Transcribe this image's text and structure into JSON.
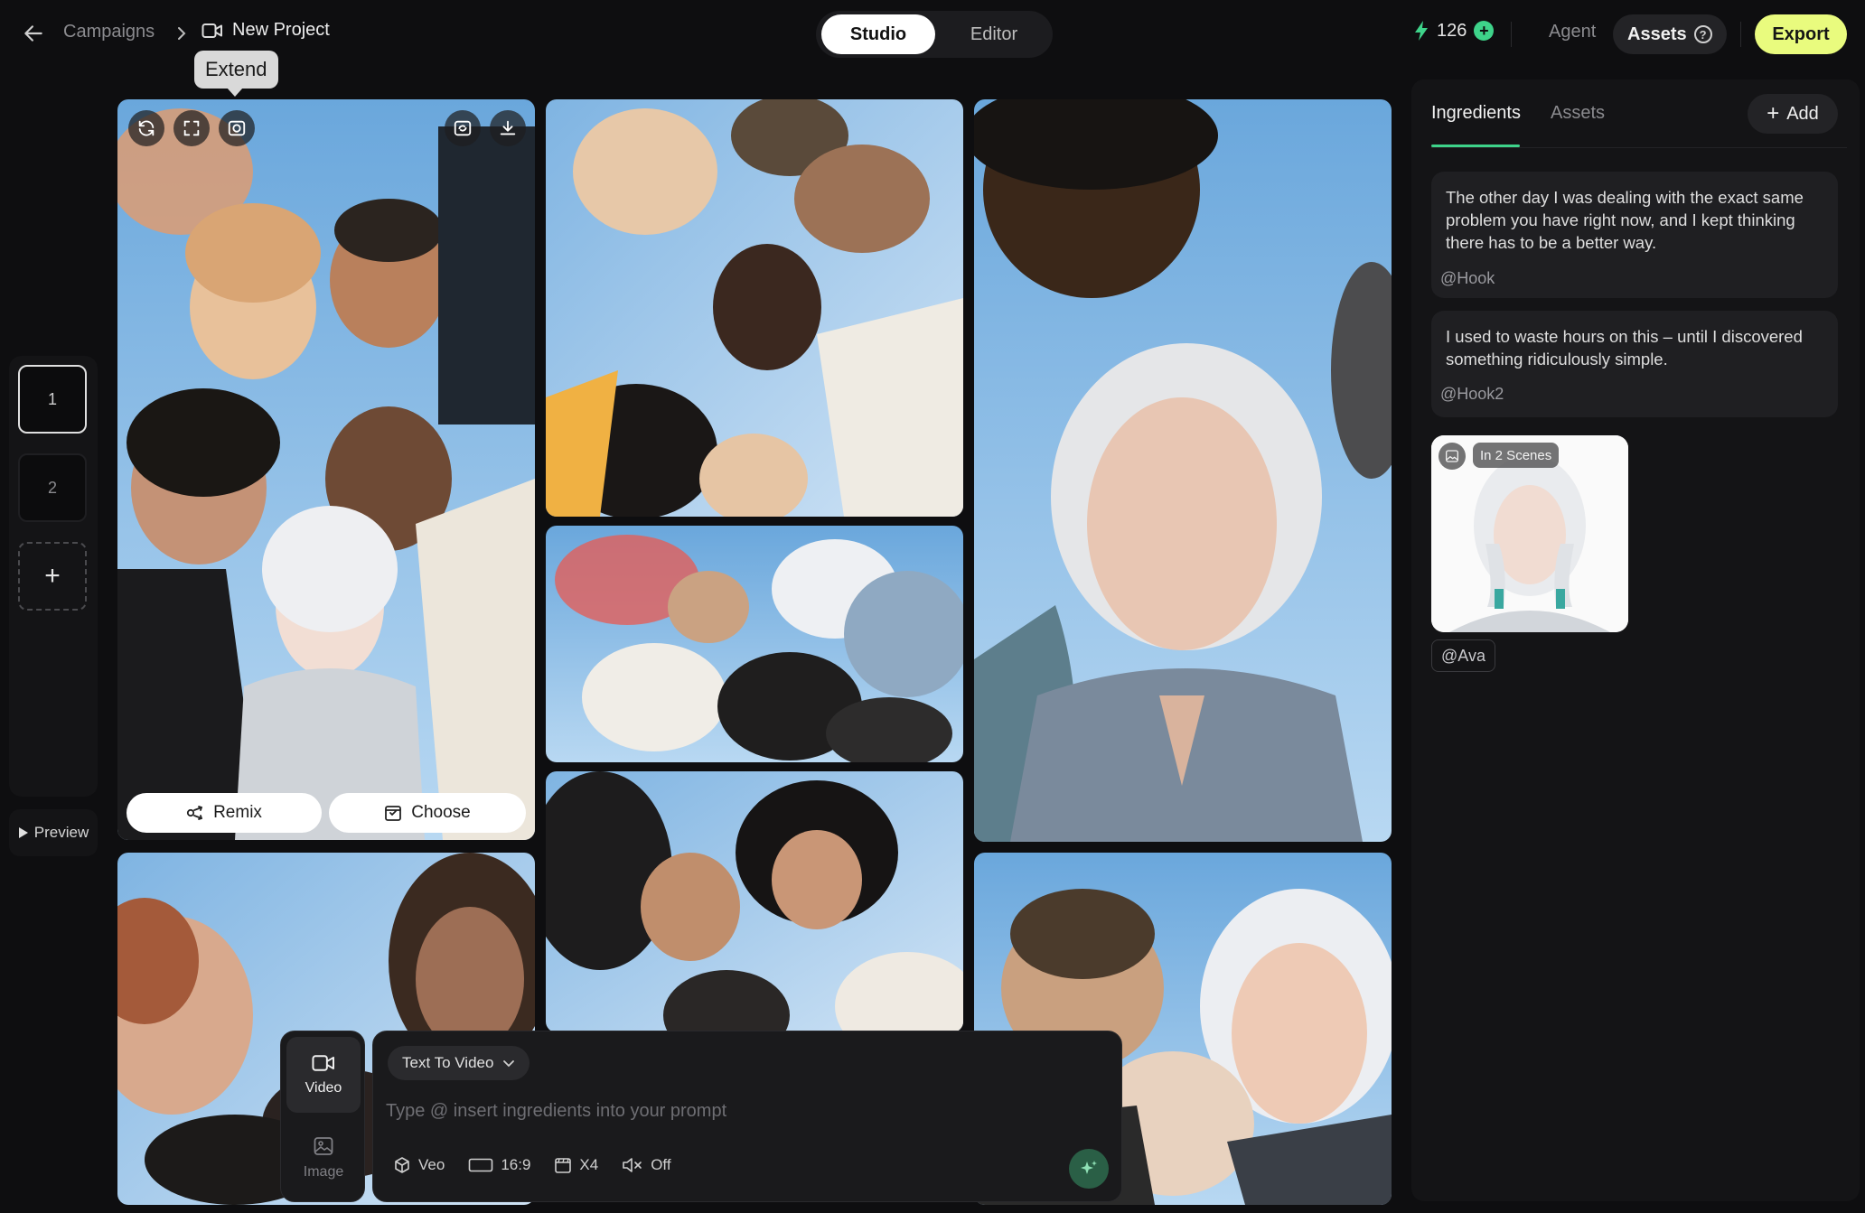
{
  "header": {
    "breadcrumb_root": "Campaigns",
    "project_name": "New Project",
    "tooltip": "Extend",
    "mode_tabs": {
      "studio": "Studio",
      "editor": "Editor"
    },
    "credits": "126",
    "agent_label": "Agent",
    "assets_label": "Assets",
    "export_label": "Export"
  },
  "scenes": {
    "items": [
      "1",
      "2"
    ],
    "preview_label": "Preview"
  },
  "gallery": {
    "remix_label": "Remix",
    "choose_label": "Choose"
  },
  "prompt": {
    "mode": "Text To Video",
    "placeholder": "Type @ insert ingredients into your prompt",
    "media": {
      "video": "Video",
      "image": "Image"
    },
    "options": {
      "model": "Veo",
      "aspect": "16:9",
      "count": "X4",
      "sound": "Off"
    }
  },
  "panel": {
    "tabs": {
      "ingredients": "Ingredients",
      "assets": "Assets"
    },
    "add_label": "Add",
    "cards": [
      {
        "text": "The other day I was dealing with the exact same problem you have right now, and I kept thinking there has to be a better way.",
        "tag": "@Hook"
      },
      {
        "text": "I used to waste hours on this – until I discovered something ridiculously simple.",
        "tag": "@Hook2"
      }
    ],
    "asset": {
      "badge": "In 2 Scenes",
      "tag": "@Ava"
    }
  },
  "colors": {
    "accent": "#3ed38a",
    "export": "#e9fb7e",
    "sky": "#8dbde6",
    "background": "#0e0e10"
  },
  "icons": [
    "back-arrow-icon",
    "chevron-right-icon",
    "video-camera-icon",
    "bolt-icon",
    "plus-icon",
    "help-icon",
    "refresh-icon",
    "fullscreen-icon",
    "extend-icon",
    "replace-image-icon",
    "download-icon",
    "remix-icon",
    "choose-icon",
    "image-icon",
    "cube-icon",
    "aspect-ratio-icon",
    "clapper-icon",
    "mute-icon",
    "sparkle-icon",
    "play-icon"
  ]
}
